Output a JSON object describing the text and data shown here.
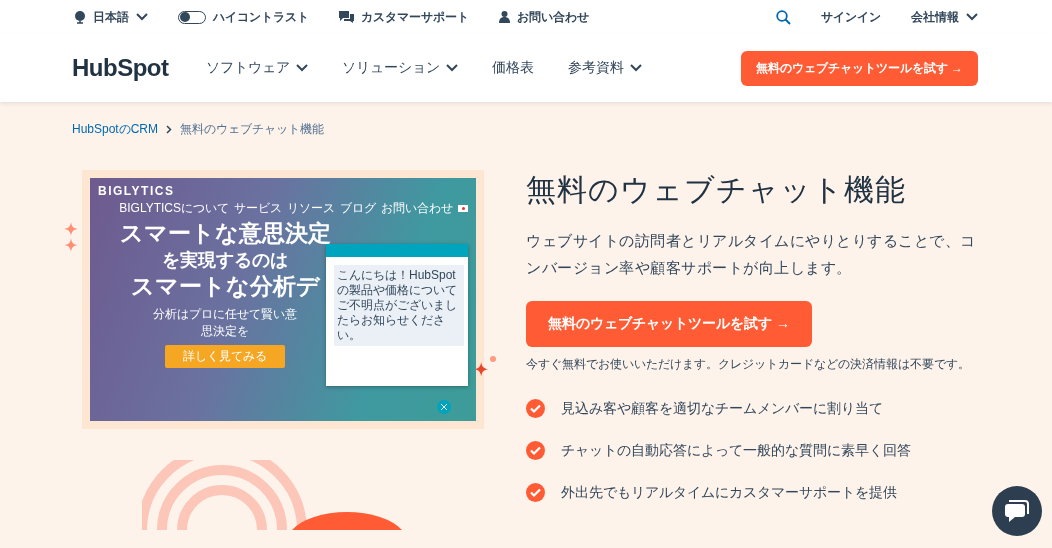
{
  "utility_bar": {
    "language": "日本語",
    "high_contrast": {
      "label": "ハイコントラスト",
      "on": false
    },
    "support": "カスタマーサポート",
    "contact": "お問い合わせ",
    "sign_in": "サインイン",
    "company": "会社情報"
  },
  "nav": {
    "logo": "HubSpot",
    "items": [
      {
        "label": "ソフトウェア",
        "dropdown": true
      },
      {
        "label": "ソリューション",
        "dropdown": true
      },
      {
        "label": "価格表",
        "dropdown": false
      },
      {
        "label": "参考資料",
        "dropdown": true
      }
    ],
    "cta": "無料のウェブチャットツールを試す →"
  },
  "breadcrumb": [
    {
      "label": "HubSpotのCRM",
      "link": true
    },
    {
      "label": "無料のウェブチャット機能",
      "link": false
    }
  ],
  "preview": {
    "brand": "BIGLYTICS",
    "nav": [
      "BIGLYTICSについて",
      "サービス",
      "リソース",
      "ブログ",
      "お問い合わせ"
    ],
    "headline": [
      "スマートな意思決定",
      "を実現するのは",
      "スマートな分析デ"
    ],
    "subtitle": "分析はプロに任せて賢い意思決定を",
    "button": "詳しく見てみる",
    "chat_message": "こんにちは！HubSpotの製品や価格についてご不明点がございましたらお知らせください。"
  },
  "hero": {
    "title": "無料のウェブチャット機能",
    "description": "ウェブサイトの訪問者とリアルタイムにやりとりすることで、コンバージョン率や顧客サポートが向上します。",
    "cta": "無料のウェブチャットツールを試す →",
    "note": "今すぐ無料でお使いいただけます。クレジットカードなどの決済情報は不要です。",
    "features": [
      "見込み客や顧客を適切なチームメンバーに割り当て",
      "チャットの自動応答によって一般的な質問に素早く回答",
      "外出先でもリアルタイムにカスタマーサポートを提供"
    ]
  }
}
